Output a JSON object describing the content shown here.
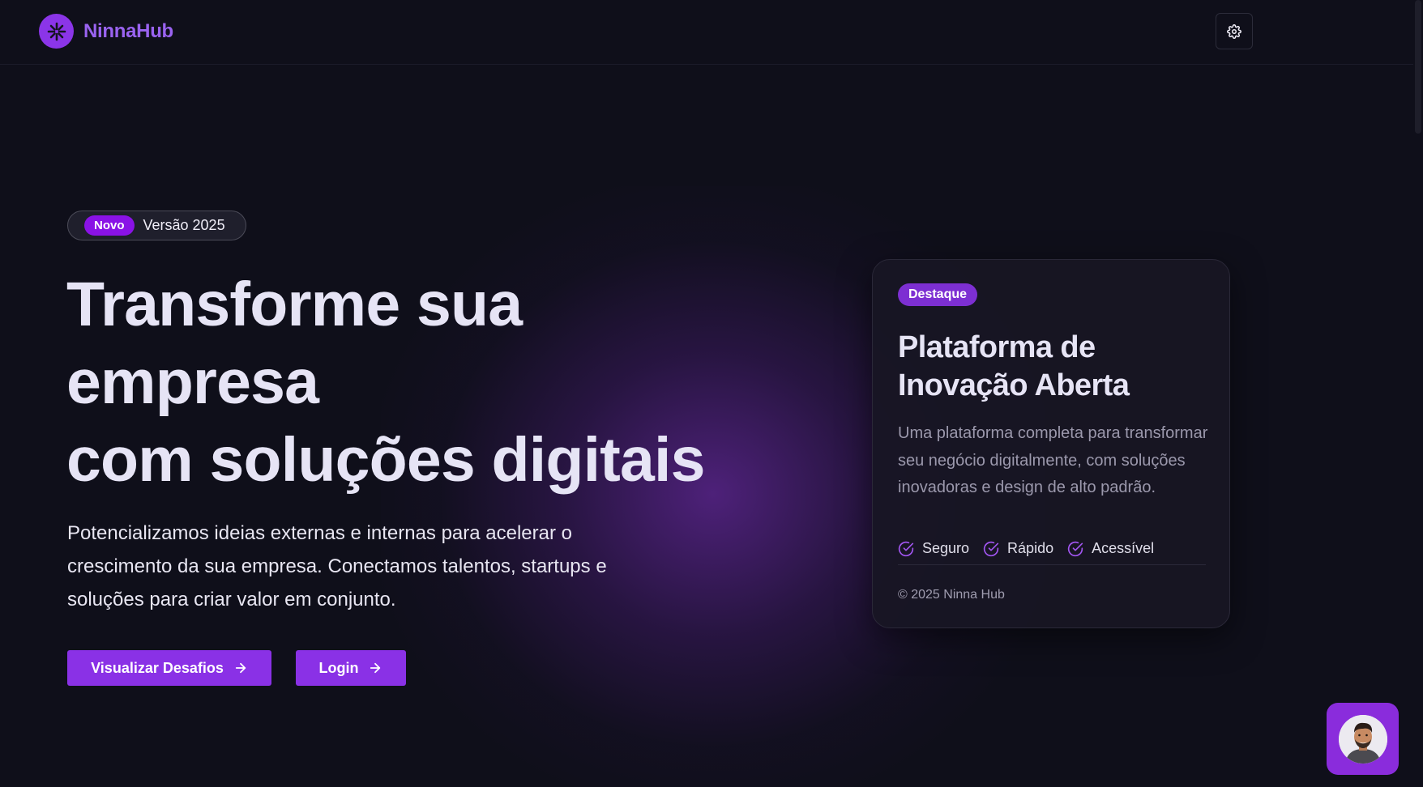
{
  "header": {
    "brand": "NinnaHub",
    "settings_icon": "gear-icon"
  },
  "hero": {
    "badge_new": "Novo",
    "badge_version": "Versão 2025",
    "title_lines": [
      "Transforme sua",
      "empresa",
      "com soluções digitais"
    ],
    "description": "Potencializamos ideias externas e internas para acelerar o crescimento da sua empresa. Conectamos talentos, startups e soluções para criar valor em conjunto.",
    "primary_button": "Visualizar Desafios",
    "secondary_button": "Login"
  },
  "card": {
    "tag": "Destaque",
    "title_lines": [
      "Plataforma de",
      "Inovação Aberta"
    ],
    "description": "Uma plataforma completa para transformar seu negócio digitalmente, com soluções inovadoras e design de alto padrão.",
    "features": [
      "Seguro",
      "Rápido",
      "Acessível"
    ],
    "footer": "© 2025 Ninna Hub"
  },
  "chat": {
    "icon": "support-avatar"
  },
  "colors": {
    "background": "#0f0f1a",
    "accent": "#8a31e6",
    "brand": "#9a63f0",
    "text": "#e6e4f5",
    "muted": "#9b98ac"
  }
}
